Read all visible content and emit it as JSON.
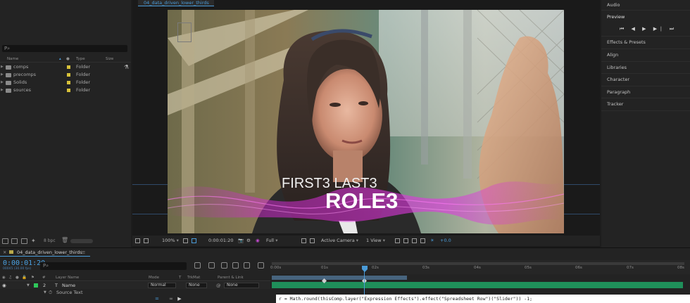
{
  "project": {
    "search_icon": "P⌕",
    "columns": {
      "name": "Name",
      "type": "Type",
      "size": "Size"
    },
    "items": [
      {
        "name": "comps",
        "type": "Folder"
      },
      {
        "name": "precomps",
        "type": "Folder"
      },
      {
        "name": "Solids",
        "type": "Folder"
      },
      {
        "name": "sources",
        "type": "Folder"
      }
    ],
    "bpc": "8 bpc"
  },
  "viewer": {
    "tab": "04_data_driven_lower_thirds",
    "lower_third": {
      "line1": "FIRST3 LAST3",
      "line2": "ROLE3"
    },
    "toolbar": {
      "zoom": "100%",
      "timecode": "0:00:01:20",
      "resolution": "Full",
      "camera": "Active Camera",
      "views": "1 View",
      "exposure": "+0.0"
    }
  },
  "right_panel": {
    "audio": "Audio",
    "preview": "Preview",
    "preview_controls": "⏮ ◀ ▶ ▶∣ ⏭",
    "panels": [
      "Effects & Presets",
      "Align",
      "Libraries",
      "Character",
      "Paragraph",
      "Tracker"
    ]
  },
  "timeline": {
    "tab": "04_data_driven_lower_thirds",
    "timecode": "0:00:01:20",
    "fps": "00045 (30.00 fps)",
    "search_placeholder": "P⌕",
    "columns": {
      "num": "#",
      "layer_name": "Layer Name",
      "mode": "Mode",
      "t": "T",
      "trkmat": "TrkMat",
      "parent": "Parent & Link"
    },
    "layer": {
      "num": "2",
      "type_icon": "T",
      "name": "Name",
      "mode": "Normal",
      "trkmat": "None",
      "parent": "None"
    },
    "sub_property": "Source Text",
    "ruler_ticks": [
      "0:00s",
      "01s",
      "02s",
      "03s",
      "04s",
      "05s",
      "06s",
      "07s",
      "08s"
    ],
    "expression": "r = Math.round(thisComp.layer(\"Expression Effects\").effect(\"Spreadsheet Row\")(\"Slider\")) -1;"
  },
  "colors": {
    "accent": "#4a9bd8",
    "folder": "#d8c23a",
    "layer_bar": "#1f8f5a",
    "lower_third_magenta": "#d22ad0"
  }
}
